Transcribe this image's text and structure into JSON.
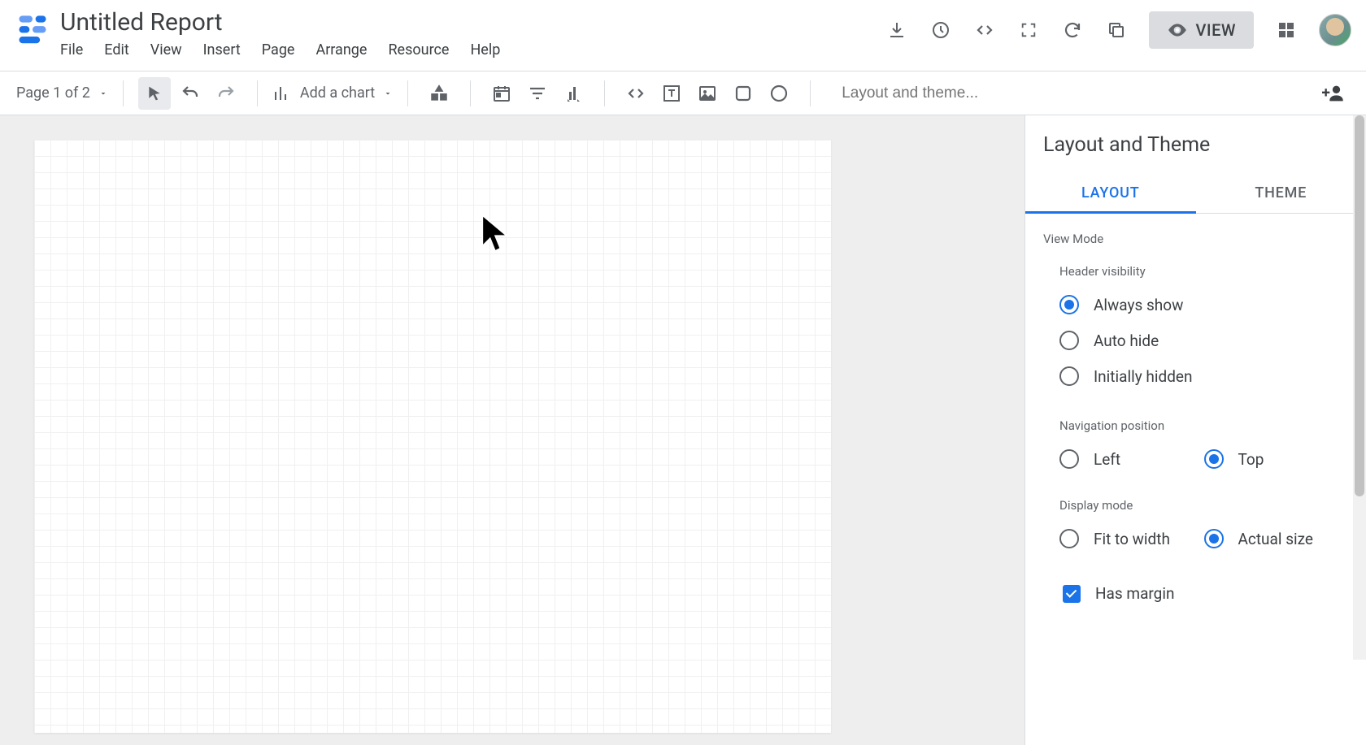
{
  "header": {
    "title": "Untitled Report",
    "menus": [
      "File",
      "Edit",
      "View",
      "Insert",
      "Page",
      "Arrange",
      "Resource",
      "Help"
    ],
    "view_button": "VIEW"
  },
  "toolbar": {
    "page_selector": "Page 1 of 2",
    "add_chart": "Add a chart",
    "layout_theme_placeholder": "Layout and theme..."
  },
  "panel": {
    "title": "Layout and Theme",
    "tabs": {
      "layout": "LAYOUT",
      "theme": "THEME"
    },
    "view_mode": {
      "section": "View Mode",
      "header_visibility": {
        "label": "Header visibility",
        "options": [
          "Always show",
          "Auto hide",
          "Initially hidden"
        ],
        "selected": 0
      },
      "navigation_position": {
        "label": "Navigation position",
        "options": [
          "Left",
          "Top"
        ],
        "selected": 1
      },
      "display_mode": {
        "label": "Display mode",
        "options": [
          "Fit to width",
          "Actual size"
        ],
        "selected": 1
      },
      "has_margin": {
        "label": "Has margin",
        "checked": true
      }
    }
  }
}
